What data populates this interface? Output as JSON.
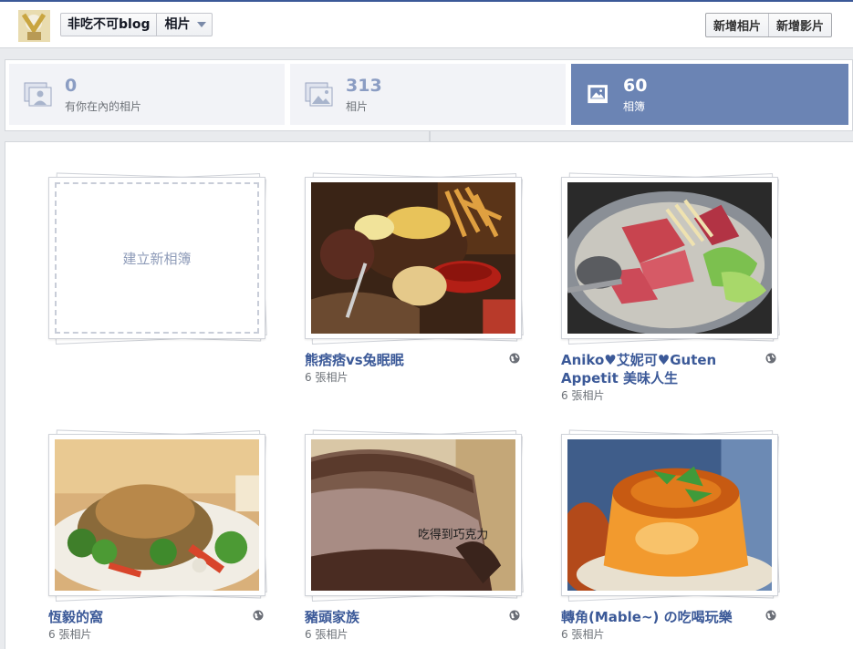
{
  "header": {
    "page_name": "非吃不可blog",
    "section": "相片",
    "add_photos": "新增相片",
    "add_videos": "新增影片"
  },
  "stats": [
    {
      "count": "0",
      "label": "有你在內的相片",
      "icon": "tagged-photos-icon"
    },
    {
      "count": "313",
      "label": "相片",
      "icon": "photos-icon"
    },
    {
      "count": "60",
      "label": "相簿",
      "icon": "albums-icon",
      "active": true
    }
  ],
  "create_album_label": "建立新相簿",
  "albums": [
    {
      "title": "熊痞痞vs兔眠眠",
      "count": "6 張相片",
      "privacy_icon": "globe-icon"
    },
    {
      "title": "Aniko♥艾妮可♥Guten Appetit 美味人生",
      "count": "6 張相片",
      "privacy_icon": "globe-icon"
    },
    {
      "title": "恆毅的窩",
      "count": "6 張相片",
      "privacy_icon": "globe-icon"
    },
    {
      "title": "豬頭家族",
      "count": "6 張相片",
      "privacy_icon": "globe-icon"
    },
    {
      "title": "轉角(Mable~) の吃喝玩樂",
      "count": "6 張相片",
      "privacy_icon": "globe-icon"
    }
  ],
  "cover_watermark": "吃得到巧克力",
  "colors": {
    "link": "#3b5998",
    "active_tab": "#6b84b4",
    "stat_number": "#8b9dc3"
  }
}
